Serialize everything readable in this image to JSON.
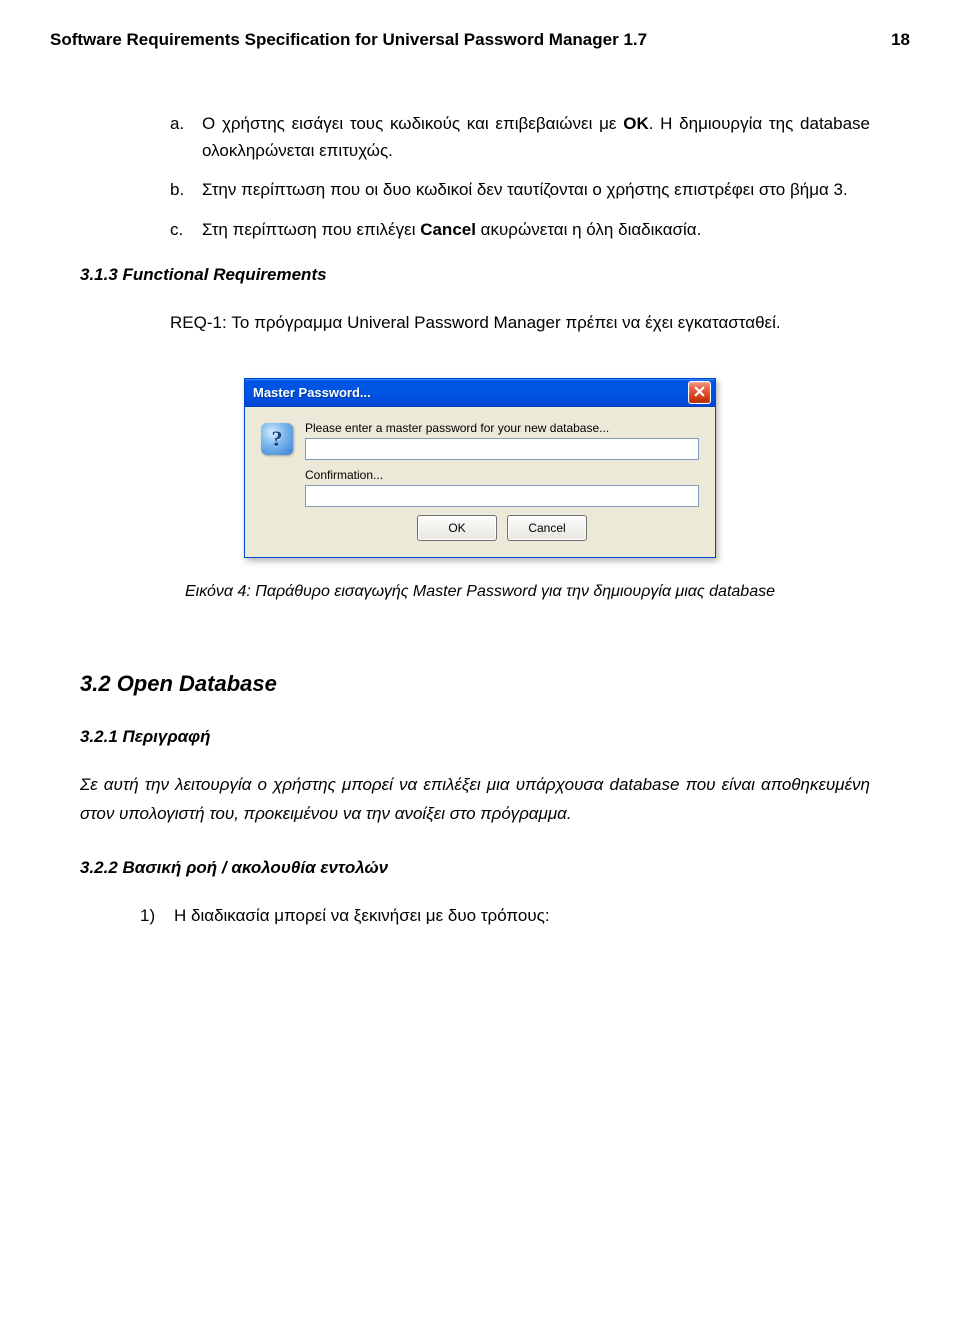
{
  "header": {
    "title": "Software Requirements Specification for Universal Password Manager 1.7",
    "page_number": "18"
  },
  "list": {
    "a_marker": "a.",
    "a_text_1": "Ο χρήστης εισάγει τους κωδικούς και επιβεβαιώνει με ",
    "a_ok": "OK",
    "a_text_2": ". Η δημιουργία της database ολοκληρώνεται επιτυχώς.",
    "b_marker": "b.",
    "b_text": "Στην περίπτωση που οι δυο κωδικοί δεν ταυτίζονται ο χρήστης επιστρέφει στο βήμα 3.",
    "c_marker": "c.",
    "c_text_1": "Στη περίπτωση που επιλέγει ",
    "c_cancel": "Cancel",
    "c_text_2": " ακυρώνεται η όλη διαδικασία."
  },
  "section_313": "3.1.3  Functional Requirements",
  "req1": "REQ-1: Το πρόγραμμα Univeral Password Manager πρέπει να έχει εγκατασταθεί.",
  "dialog": {
    "title": "Master Password...",
    "prompt": "Please enter a master password for your new database...",
    "confirmation": "Confirmation...",
    "ok": "OK",
    "cancel": "Cancel",
    "question_glyph": "?"
  },
  "caption": "Εικόνα 4: Παράθυρο εισαγωγής Master Password για την δημιουργία μιας database",
  "section_32": "3.2  Open Database",
  "section_321": "3.2.1  Περιγραφή",
  "para_321": "Σε αυτή την λειτουργία ο χρήστης μπορεί να επιλέξει μια υπάρχουσα database που είναι αποθηκευμένη στον υπολογιστή του, προκειμένου να την ανοίξει στο πρόγραμμα.",
  "section_322": "3.2.2  Βασική ροή / ακολουθία εντολών",
  "list2": {
    "marker_1": "1)",
    "text_1": "Η διαδικασία μπορεί να ξεκινήσει με δυο τρόπους:"
  }
}
